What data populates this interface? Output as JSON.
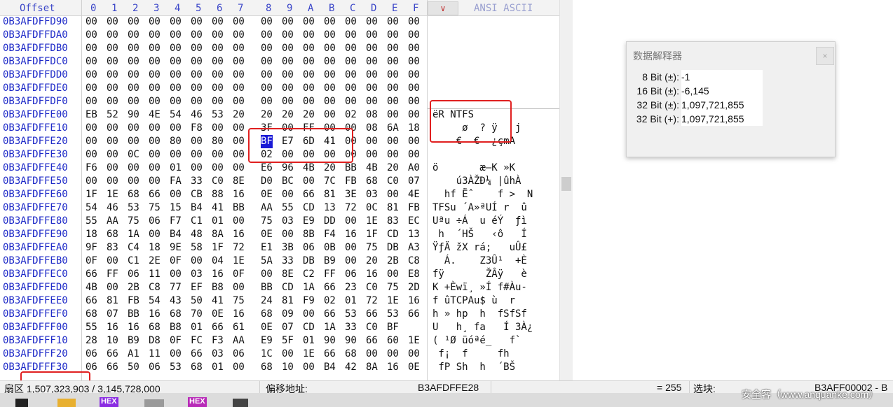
{
  "header": {
    "offset_label": "Offset",
    "columns": [
      "0",
      "1",
      "2",
      "3",
      "4",
      "5",
      "6",
      "7",
      "8",
      "9",
      "A",
      "B",
      "C",
      "D",
      "E",
      "F"
    ],
    "charset_dropdown": "∨",
    "charset_label": "ANSI ASCII"
  },
  "rows": [
    {
      "off": "0B3AFDFFD90",
      "hex": [
        "00",
        "00",
        "00",
        "00",
        "00",
        "00",
        "00",
        "00",
        "00",
        "00",
        "00",
        "00",
        "00",
        "00",
        "00",
        "00"
      ],
      "ascii": ""
    },
    {
      "off": "0B3AFDFFDA0",
      "hex": [
        "00",
        "00",
        "00",
        "00",
        "00",
        "00",
        "00",
        "00",
        "00",
        "00",
        "00",
        "00",
        "00",
        "00",
        "00",
        "00"
      ],
      "ascii": ""
    },
    {
      "off": "0B3AFDFFDB0",
      "hex": [
        "00",
        "00",
        "00",
        "00",
        "00",
        "00",
        "00",
        "00",
        "00",
        "00",
        "00",
        "00",
        "00",
        "00",
        "00",
        "00"
      ],
      "ascii": ""
    },
    {
      "off": "0B3AFDFFDC0",
      "hex": [
        "00",
        "00",
        "00",
        "00",
        "00",
        "00",
        "00",
        "00",
        "00",
        "00",
        "00",
        "00",
        "00",
        "00",
        "00",
        "00"
      ],
      "ascii": ""
    },
    {
      "off": "0B3AFDFFDD0",
      "hex": [
        "00",
        "00",
        "00",
        "00",
        "00",
        "00",
        "00",
        "00",
        "00",
        "00",
        "00",
        "00",
        "00",
        "00",
        "00",
        "00"
      ],
      "ascii": ""
    },
    {
      "off": "0B3AFDFFDE0",
      "hex": [
        "00",
        "00",
        "00",
        "00",
        "00",
        "00",
        "00",
        "00",
        "00",
        "00",
        "00",
        "00",
        "00",
        "00",
        "00",
        "00"
      ],
      "ascii": ""
    },
    {
      "off": "0B3AFDFFDF0",
      "hex": [
        "00",
        "00",
        "00",
        "00",
        "00",
        "00",
        "00",
        "00",
        "00",
        "00",
        "00",
        "00",
        "00",
        "00",
        "00",
        "00"
      ],
      "ascii": ""
    },
    {
      "off": "0B3AFDFFE00",
      "hex": [
        "EB",
        "52",
        "90",
        "4E",
        "54",
        "46",
        "53",
        "20",
        "20",
        "20",
        "20",
        "00",
        "02",
        "08",
        "00",
        "00"
      ],
      "ascii": "ëR NTFS"
    },
    {
      "off": "0B3AFDFFE10",
      "hex": [
        "00",
        "00",
        "00",
        "00",
        "00",
        "F8",
        "00",
        "00",
        "3F",
        "00",
        "FF",
        "00",
        "00",
        "08",
        "6A",
        "18"
      ],
      "ascii": "     ø  ? ÿ   j"
    },
    {
      "off": "0B3AFDFFE20",
      "hex": [
        "00",
        "00",
        "00",
        "00",
        "80",
        "00",
        "80",
        "00",
        "BF",
        "E7",
        "6D",
        "41",
        "00",
        "00",
        "00",
        "00"
      ],
      "ascii": "    €  €  ¿çmA"
    },
    {
      "off": "0B3AFDFFE30",
      "hex": [
        "00",
        "00",
        "0C",
        "00",
        "00",
        "00",
        "00",
        "00",
        "02",
        "00",
        "00",
        "00",
        "00",
        "00",
        "00",
        "00"
      ],
      "ascii": ""
    },
    {
      "off": "0B3AFDFFE40",
      "hex": [
        "F6",
        "00",
        "00",
        "00",
        "01",
        "00",
        "00",
        "00",
        "E6",
        "96",
        "4B",
        "20",
        "BB",
        "4B",
        "20",
        "A0"
      ],
      "ascii": "ö       æ–K »K"
    },
    {
      "off": "0B3AFDFFE50",
      "hex": [
        "00",
        "00",
        "00",
        "00",
        "FA",
        "33",
        "C0",
        "8E",
        "D0",
        "BC",
        "00",
        "7C",
        "FB",
        "68",
        "C0",
        "07"
      ],
      "ascii": "    ú3ÀŽÐ¼ |ûhÀ"
    },
    {
      "off": "0B3AFDFFE60",
      "hex": [
        "1F",
        "1E",
        "68",
        "66",
        "00",
        "CB",
        "88",
        "16",
        "0E",
        "00",
        "66",
        "81",
        "3E",
        "03",
        "00",
        "4E"
      ],
      "ascii": "  hf Ëˆ    f >  N"
    },
    {
      "off": "0B3AFDFFE70",
      "hex": [
        "54",
        "46",
        "53",
        "75",
        "15",
        "B4",
        "41",
        "BB",
        "AA",
        "55",
        "CD",
        "13",
        "72",
        "0C",
        "81",
        "FB"
      ],
      "ascii": "TFSu ´A»ªUÍ r  û"
    },
    {
      "off": "0B3AFDFFE80",
      "hex": [
        "55",
        "AA",
        "75",
        "06",
        "F7",
        "C1",
        "01",
        "00",
        "75",
        "03",
        "E9",
        "DD",
        "00",
        "1E",
        "83",
        "EC"
      ],
      "ascii": "Uªu ÷Á  u éÝ  ƒì"
    },
    {
      "off": "0B3AFDFFE90",
      "hex": [
        "18",
        "68",
        "1A",
        "00",
        "B4",
        "48",
        "8A",
        "16",
        "0E",
        "00",
        "8B",
        "F4",
        "16",
        "1F",
        "CD",
        "13"
      ],
      "ascii": " h  ´HŠ   ‹ô   Í"
    },
    {
      "off": "0B3AFDFFEA0",
      "hex": [
        "9F",
        "83",
        "C4",
        "18",
        "9E",
        "58",
        "1F",
        "72",
        "E1",
        "3B",
        "06",
        "0B",
        "00",
        "75",
        "DB",
        "A3"
      ],
      "ascii": "ŸƒÄ žX rá;   uÛ£"
    },
    {
      "off": "0B3AFDFFEB0",
      "hex": [
        "0F",
        "00",
        "C1",
        "2E",
        "0F",
        "00",
        "04",
        "1E",
        "5A",
        "33",
        "DB",
        "B9",
        "00",
        "20",
        "2B",
        "C8"
      ],
      "ascii": "  Á.    Z3Û¹  +È"
    },
    {
      "off": "0B3AFDFFEC0",
      "hex": [
        "66",
        "FF",
        "06",
        "11",
        "00",
        "03",
        "16",
        "0F",
        "00",
        "8E",
        "C2",
        "FF",
        "06",
        "16",
        "00",
        "E8"
      ],
      "ascii": "fÿ       ŽÂÿ   è"
    },
    {
      "off": "0B3AFDFFED0",
      "hex": [
        "4B",
        "00",
        "2B",
        "C8",
        "77",
        "EF",
        "B8",
        "00",
        "BB",
        "CD",
        "1A",
        "66",
        "23",
        "C0",
        "75",
        "2D"
      ],
      "ascii": "K +Èwï¸ »Í f#Àu-"
    },
    {
      "off": "0B3AFDFFEE0",
      "hex": [
        "66",
        "81",
        "FB",
        "54",
        "43",
        "50",
        "41",
        "75",
        "24",
        "81",
        "F9",
        "02",
        "01",
        "72",
        "1E",
        "16"
      ],
      "ascii": "f ûTCPAu$ ù  r"
    },
    {
      "off": "0B3AFDFFEF0",
      "hex": [
        "68",
        "07",
        "BB",
        "16",
        "68",
        "70",
        "0E",
        "16",
        "68",
        "09",
        "00",
        "66",
        "53",
        "66",
        "53",
        "66"
      ],
      "ascii": "h » hp  h  fSfSf"
    },
    {
      "off": "0B3AFDFFF00",
      "hex": [
        "55",
        "16",
        "16",
        "68",
        "B8",
        "01",
        "66",
        "61",
        "0E",
        "07",
        "CD",
        "1A",
        "33",
        "C0",
        "BF"
      ],
      "ascii": "U   h¸ fa   Í 3À¿"
    },
    {
      "off": "0B3AFDFFF10",
      "hex": [
        "28",
        "10",
        "B9",
        "D8",
        "0F",
        "FC",
        "F3",
        "AA",
        "E9",
        "5F",
        "01",
        "90",
        "90",
        "66",
        "60",
        "1E"
      ],
      "ascii": "( ¹Ø üóªé_   f`"
    },
    {
      "off": "0B3AFDFFF20",
      "hex": [
        "06",
        "66",
        "A1",
        "11",
        "00",
        "66",
        "03",
        "06",
        "1C",
        "00",
        "1E",
        "66",
        "68",
        "00",
        "00",
        "00"
      ],
      "ascii": " f¡  f     fh"
    },
    {
      "off": "0B3AFDFFF30",
      "hex": [
        "06",
        "66",
        "50",
        "06",
        "53",
        "68",
        "01",
        "00",
        "68",
        "10",
        "00",
        "B4",
        "42",
        "8A",
        "16",
        "0E"
      ],
      "ascii": " fP Sh  h  ´BŠ"
    }
  ],
  "interpreter": {
    "title": "数据解释器",
    "close": "×",
    "rows": [
      {
        "label": "8 Bit (±):",
        "value": "-1"
      },
      {
        "label": "16 Bit (±):",
        "value": "-6,145"
      },
      {
        "label": "32 Bit (±):",
        "value": "1,097,721,855"
      },
      {
        "label": "32 Bit (+):",
        "value": "1,097,721,855"
      }
    ]
  },
  "status": {
    "sector": "扇区 1,507,323,903 / 3,145,728,000",
    "offset_label": "偏移地址:",
    "offset_value": "B3AFDFFE28",
    "eq_value": "= 255",
    "block_label": "选块:",
    "block_value": "B3AFF00002 - B"
  },
  "taskbar": {
    "hex1": "HEX",
    "hex2": "HEX"
  },
  "watermark": "安全客（www.anquanke.com）",
  "colors": {
    "offset_blue": "#1e2ac8",
    "highlight_red": "#e02020",
    "selection": "#1a1ad6"
  }
}
